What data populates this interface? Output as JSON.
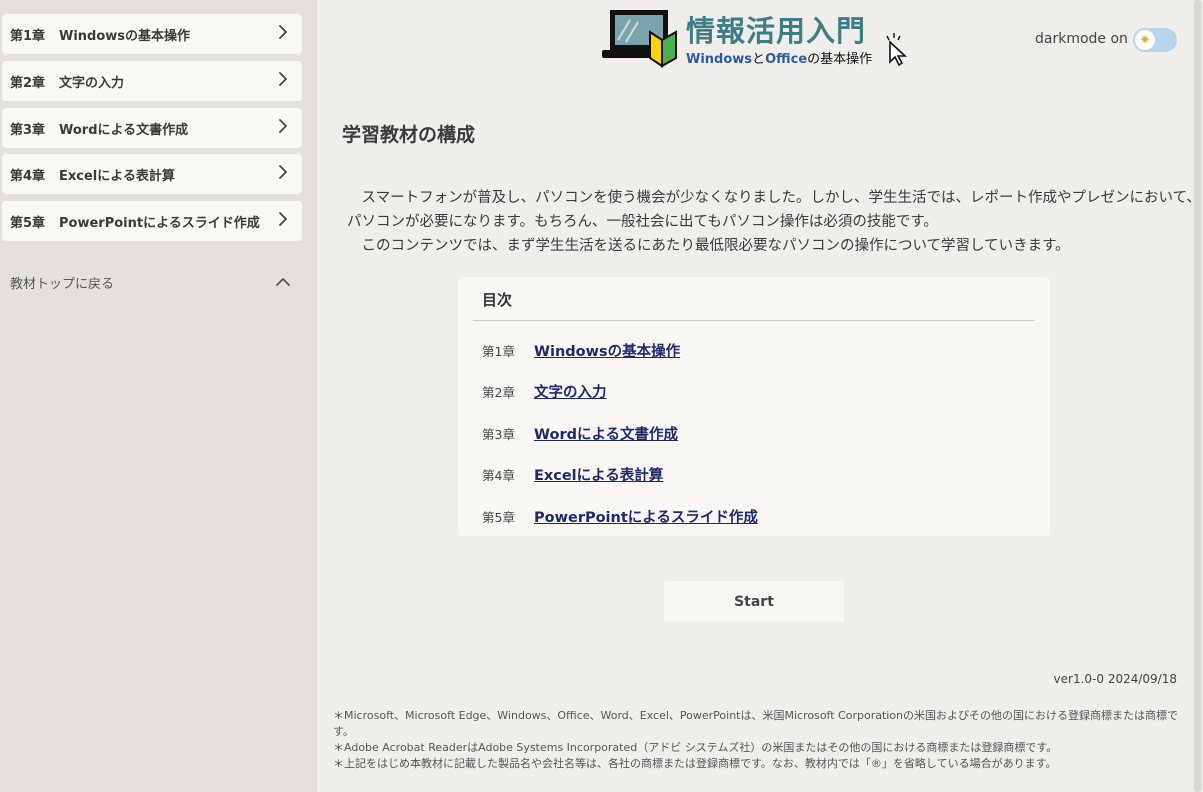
{
  "sidebar": {
    "chapters": [
      {
        "num": "第1章",
        "title": "Windowsの基本操作"
      },
      {
        "num": "第2章",
        "title": "文字の入力"
      },
      {
        "num": "第3章",
        "title": "Wordによる文書作成"
      },
      {
        "num": "第4章",
        "title": "Excelによる表計算"
      },
      {
        "num": "第5章",
        "title": "PowerPointによるスライド作成"
      }
    ],
    "back_label": "教材トップに戻る"
  },
  "header": {
    "logo_title": "情報活用入門",
    "logo_sub_windows": "Windows",
    "logo_sub_to": "と",
    "logo_sub_office": "Office",
    "logo_sub_rest": "の基本操作",
    "darkmode_label": "darkmode on",
    "darkmode_icon": "sun-icon"
  },
  "main": {
    "section_title": "学習教材の構成",
    "intro": [
      "　スマートフォンが普及し、パソコンを使う機会が少なくなりました。しかし、学生生活では、レポート作成やプレゼンにおいて、",
      "パソコンが必要になります。もちろん、一般社会に出てもパソコン操作は必須の技能です。",
      "　このコンテンツでは、まず学生生活を送るにあたり最低限必要なパソコンの操作について学習していきます。"
    ],
    "toc": {
      "title": "目次",
      "items": [
        {
          "num": "第1章",
          "title": "Windowsの基本操作"
        },
        {
          "num": "第2章",
          "title": "文字の入力"
        },
        {
          "num": "第3章",
          "title": "Wordによる文書作成"
        },
        {
          "num": "第4章",
          "title": "Excelによる表計算"
        },
        {
          "num": "第5章",
          "title": "PowerPointによるスライド作成"
        }
      ]
    },
    "start_label": "Start"
  },
  "footer": {
    "version": "ver1.0-0 2024/09/18",
    "notes": [
      "＊Microsoft、Microsoft Edge、Windows、Office、Word、Excel、PowerPointは、米国Microsoft Corporationの米国およびその他の国における登録商標または商標で",
      "す。",
      "＊Adobe Acrobat ReaderはAdobe Systems Incorporated（アドビ システムズ社）の米国またはその他の国における商標または登録商標です。",
      "＊上記をはじめ本教材に記載した製品名や会社名等は、各社の商標または登録商標です。なお、教材内では「®」を省略している場合があります。"
    ]
  },
  "colors": {
    "accent": "#3e7d86",
    "link": "#1f2a6b",
    "toggle": "#b8d4ec"
  }
}
